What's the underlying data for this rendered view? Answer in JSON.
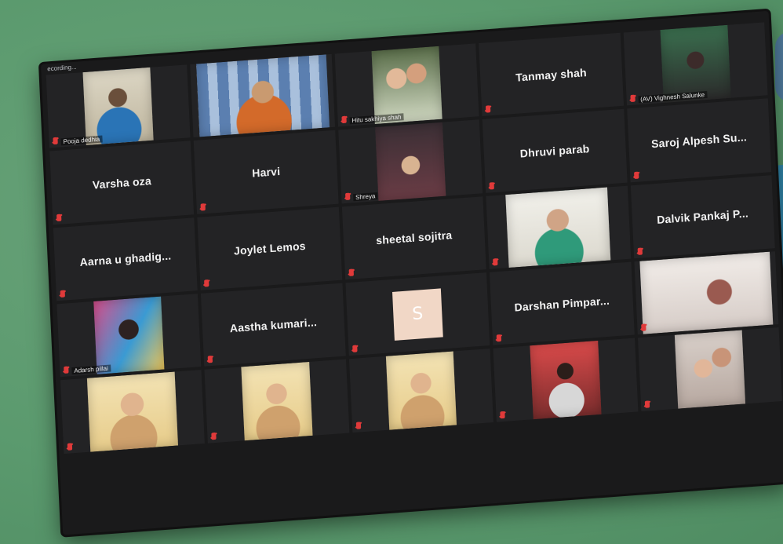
{
  "status_text": "ecording...",
  "participants": [
    {
      "name": "Pooja dedhia",
      "mode": "video",
      "label": true
    },
    {
      "name": "",
      "mode": "video",
      "label": false
    },
    {
      "name": "Hitu sakhiya shah",
      "mode": "video",
      "label": true
    },
    {
      "name": "Tanmay shah",
      "mode": "name",
      "label": false
    },
    {
      "name": "(AV) Vighnesh Salunke",
      "mode": "video",
      "label": true
    },
    {
      "name": "Varsha oza",
      "mode": "name",
      "label": false
    },
    {
      "name": "Harvi",
      "mode": "name",
      "label": false
    },
    {
      "name": "Shreya",
      "mode": "video",
      "label": true
    },
    {
      "name": "Dhruvi parab",
      "mode": "name",
      "label": false
    },
    {
      "name": "Saroj Alpesh Su...",
      "mode": "name",
      "label": false
    },
    {
      "name": "Aarna u ghadig...",
      "mode": "name",
      "label": false
    },
    {
      "name": "Joylet Lemos",
      "mode": "name",
      "label": false
    },
    {
      "name": "sheetal sojitra",
      "mode": "name",
      "label": false
    },
    {
      "name": "",
      "mode": "video",
      "label": false
    },
    {
      "name": "Dalvik Pankaj P...",
      "mode": "name",
      "label": false
    },
    {
      "name": "Adarsh pillai",
      "mode": "video",
      "label": true
    },
    {
      "name": "Aastha kumari...",
      "mode": "name",
      "label": false
    },
    {
      "name": "",
      "mode": "avatar",
      "label": false
    },
    {
      "name": "Darshan Pimpar...",
      "mode": "name",
      "label": false
    },
    {
      "name": "",
      "mode": "video",
      "label": false
    },
    {
      "name": "",
      "mode": "video",
      "label": false
    },
    {
      "name": "",
      "mode": "video",
      "label": false
    },
    {
      "name": "",
      "mode": "video",
      "label": false
    },
    {
      "name": "",
      "mode": "video",
      "label": false
    },
    {
      "name": "",
      "mode": "video",
      "label": false
    }
  ],
  "avatar_letter": "S",
  "colors": {
    "background": "#5b9a6e",
    "screen": "#1a1a1b",
    "tile": "#232325",
    "muted_mic": "#e03a3a"
  },
  "icons": [
    "muted-mic-icon"
  ]
}
